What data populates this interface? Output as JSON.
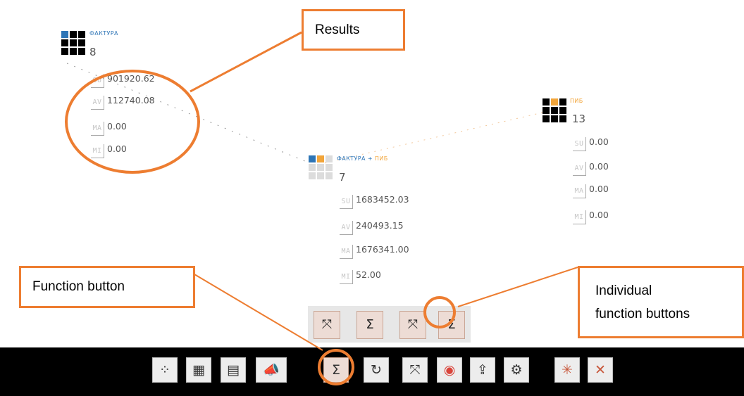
{
  "nodes": {
    "faktura": {
      "title": "ФАКТУРА",
      "count": "8",
      "stats": [
        {
          "key": "SU",
          "value": "901920.62"
        },
        {
          "key": "AV",
          "value": "112740.08"
        },
        {
          "key": "MA",
          "value": "0.00"
        },
        {
          "key": "MI",
          "value": "0.00"
        }
      ]
    },
    "pib": {
      "title": "ПИБ",
      "count": "13",
      "stats": [
        {
          "key": "SU",
          "value": "0.00"
        },
        {
          "key": "AV",
          "value": "0.00"
        },
        {
          "key": "MA",
          "value": "0.00"
        },
        {
          "key": "MI",
          "value": "0.00"
        }
      ]
    },
    "combined": {
      "title_a": "ФАКТУРА",
      "title_sep": " + ",
      "title_b": "ПИБ",
      "count": "7",
      "stats": [
        {
          "key": "SU",
          "value": "1683452.03"
        },
        {
          "key": "AV",
          "value": "240493.15"
        },
        {
          "key": "MA",
          "value": "1676341.00"
        },
        {
          "key": "MI",
          "value": "52.00"
        }
      ]
    }
  },
  "callouts": {
    "results": "Results",
    "function_button": "Function button",
    "individual_line1": "Individual",
    "individual_line2": "function buttons"
  },
  "function_bar": {
    "buttons": [
      {
        "name": "collapse-arrows-icon",
        "glyph": "⤧"
      },
      {
        "name": "sum-icon",
        "glyph": "Σ"
      },
      {
        "name": "collapse-grid-icon",
        "glyph": "⤧"
      },
      {
        "name": "sum-individual-icon",
        "glyph": "Σ"
      }
    ]
  },
  "toolbar": {
    "buttons": [
      {
        "name": "layout-icon",
        "glyph": "⁘"
      },
      {
        "name": "table-icon",
        "glyph": "▦"
      },
      {
        "name": "spreadsheet-icon",
        "glyph": "▤"
      },
      {
        "name": "megaphone-icon",
        "glyph": "📣"
      },
      {
        "name": "function-sum-icon",
        "glyph": "Σ"
      },
      {
        "name": "refresh-icon",
        "glyph": "↻"
      },
      {
        "name": "collapse-icon",
        "glyph": "⤧"
      },
      {
        "name": "lifebuoy-icon",
        "glyph": "◉"
      },
      {
        "name": "export-icon",
        "glyph": "⇪"
      },
      {
        "name": "settings-icon",
        "glyph": "⚙"
      },
      {
        "name": "explode-icon",
        "glyph": "✳"
      },
      {
        "name": "close-icon",
        "glyph": "✕"
      }
    ]
  },
  "colors": {
    "accent": "#ed7d31",
    "blue": "#2e75b6",
    "orange": "#f2a53a",
    "black": "#000000"
  }
}
